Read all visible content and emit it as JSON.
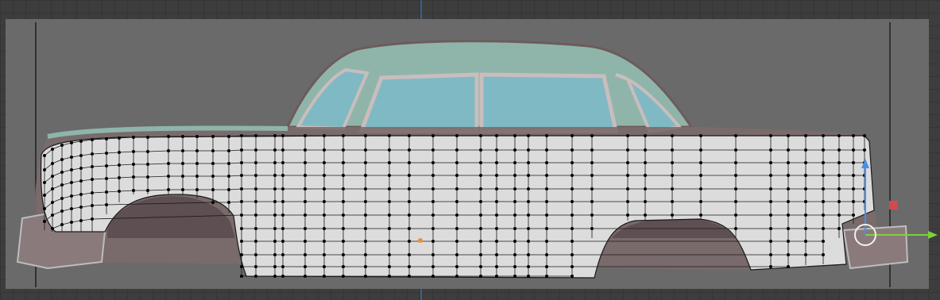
{
  "app": "3D viewport",
  "view": {
    "mode": "edit-mode",
    "projection": "orthographic-side",
    "reference_image": "vintage-sedan-side-view",
    "overlay_mesh": "car-body-quad-mesh"
  },
  "colors": {
    "grid_bg": "#3d3d3d",
    "grid_line": "#353535",
    "camera_frame": "#6a6a6a",
    "mesh_face": "#dcdcdc",
    "mesh_edge": "#1a1a1a",
    "vertex": "#000000",
    "gizmo_x": "#7fd23a",
    "gizmo_z": "#4a8eea",
    "gizmo_y_handle": "#d24a4a",
    "origin_dot": "#e8903a",
    "car_roof": "#8fb5aa",
    "car_glass": "#7fb9c4",
    "frame_center_line": "#3a6fa8"
  },
  "gizmo": {
    "axes": [
      "x-arrow-icon",
      "z-arrow-icon",
      "y-plane-handle-icon",
      "pivot-circle-icon"
    ]
  }
}
